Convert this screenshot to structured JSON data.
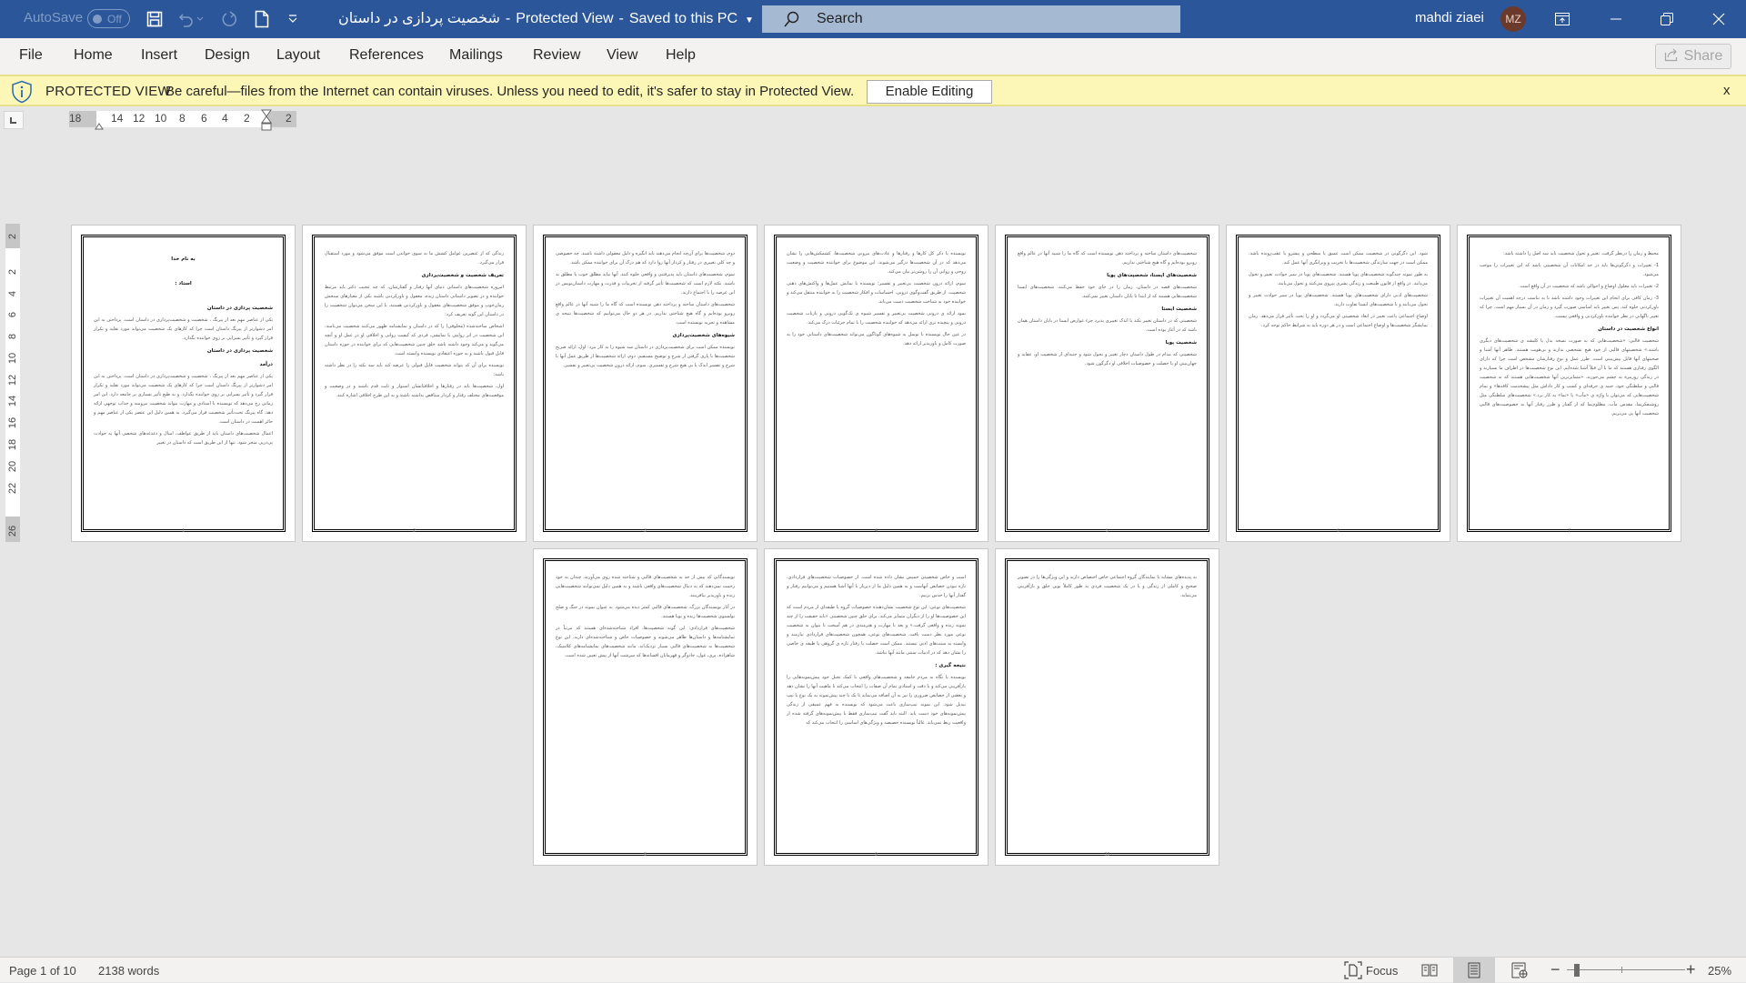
{
  "titlebar": {
    "autosave_label": "AutoSave",
    "autosave_state": "Off",
    "doc_title": "شخصیت پردازی در داستان",
    "view_mode": "Protected View",
    "save_status": "Saved to this PC",
    "search_placeholder": "Search",
    "user_name": "mahdi ziaei",
    "user_initials": "MZ",
    "icons": [
      "save-icon",
      "undo-icon",
      "redo-icon",
      "new-document-icon",
      "customize-toolbar-icon"
    ]
  },
  "menu": {
    "items": [
      "File",
      "Home",
      "Insert",
      "Design",
      "Layout",
      "References",
      "Mailings",
      "Review",
      "View",
      "Help"
    ],
    "share_label": "Share"
  },
  "protected_view": {
    "title": "PROTECTED VIEW",
    "message": "Be careful—files from the Internet can contain viruses. Unless you need to edit, it's safer to stay in Protected View.",
    "enable_label": "Enable Editing",
    "close_label": "x"
  },
  "rulers": {
    "horizontal": [
      "18",
      "14",
      "12",
      "10",
      "8",
      "6",
      "4",
      "2",
      "2"
    ],
    "vertical": [
      "2",
      "2",
      "4",
      "6",
      "8",
      "10",
      "12",
      "14",
      "16",
      "18",
      "20",
      "22",
      "26"
    ]
  },
  "pages": [
    {
      "number": "1",
      "blocks": [
        {
          "type": "title",
          "text": "به نام خدا"
        },
        {
          "type": "title",
          "text": "استاد :"
        },
        {
          "type": "h",
          "text": "شخصیت پردازی در داستان"
        },
        {
          "type": "p",
          "text": "یکی از عناصر مهم بعد از پیرنگ ، شخصیت و شخصیت‌پردازی در داستان است. پرداختن به این امر دشوارتر از پیرنگ داستان است چرا که کارهای یک شخصیت می‌تواند مورد تقلید و تکرار قرار گیرد و تأثیر بسزایی بر روی خواننده بگذارد."
        },
        {
          "type": "h",
          "text": "شخصیت پردازی در داستان"
        },
        {
          "type": "h",
          "text": "درآمد"
        },
        {
          "type": "p",
          "text": "یکی از عناصر مهم بعد از پیرنگ ، شخصیت و شخصیت‌پردازی در داستان است. پرداختن به این امر دشوارتر از پیرنگ داستان است چرا که کارهای یک شخصیت می‌تواند مورد تقلید و تکرار قرار گیرد و تأثیر بسزایی بر روی خواننده بگذارد. و به طبع تأثیر بسیاری بر جامعه دارد. این امر زمانی رخ می‌دهد که نویسنده با استادی و مهارت بتواند شخصیت نیرومند و جذاب توجهی ارائه دهد. گاه پیرنگ تحت‌تأثیر شخصیت قرار می‌گیرد. به همین دلیل این عنصر یکی از عناصر مهم و حائز اهمیت در داستان است."
        },
        {
          "type": "p",
          "text": "اعمال شخصیت‌های داستان باید از طریق عواطف، امیال و دغدغه‌های شخصی آنها به حوادث پی‌درپی منجر شود. تنها از این طریق است که داستان در تغییر"
        }
      ]
    },
    {
      "number": "2",
      "blocks": [
        {
          "type": "p",
          "text": "زندگی که از عنصرین عوامل کشش ما به سوی خواندن است موفق می‌شود و مورد استقبال قرار می‌گیرد."
        },
        {
          "type": "h",
          "text": "تعریف شخصیت و شخصیت‌پردازی"
        },
        {
          "type": "p",
          "text": "امروزه شخصیت‌های داستانی دنیای آنها رفتار و گفتارشان، که چه عجیب دکتر باید مرتبط خواننده و در تصویر داستانی داستان زنده، معقول و باورکردنی باشند یکی از معیارهای سنجش رمان‌خوب و موفق شخصیت‌های معقول و باورکردنی هستند. با این سخن می‌توان شخصیت را در داستان این گونه تعریف کرد:"
        },
        {
          "type": "p",
          "text": "اشخاص ساخته‌شده (مخلوقی) را که در داستان و نمایشنامه ظهور می‌کنند شخصیت می‌نامند. این شخصیت در اثر روایتی یا نمایشی، فردی که کیفیت روانی و اخلاقی او در عمل او و آنچه می‌گوید و می‌کند وجود داشته باشد خلق چنین شخصیت‌هایی که برای خواننده در حوزه داستان قابل قبول باشند و به حوزه اعتقادی نویسنده وابسته است."
        },
        {
          "type": "p",
          "text": "نویسنده برای آن که بتواند شخصیت قابل قبولی را عرضه کند باید سه نکته را در نظر داشته باشد:"
        },
        {
          "type": "p",
          "text": "اول، شخصیت‌ها باید در رفتارها و اخلاقیاتشان استوار و ثابت قدم باشند و در وضعیت و موقعیت‌های مختلف رفتار و کردار متناقض نداشته باشند و به این طرح اخلاقی اشاره کنند."
        }
      ]
    },
    {
      "number": "3",
      "blocks": [
        {
          "type": "p",
          "text": "دوم، شخصیت‌ها برای آن‌چه انجام می‌دهند باید انگیزه و دلیل معقولی داشته باشند. چه خصوصی و چه کلی تغییری در رفتار و کردار آنها روا دارد که هم درک آن برای خواننده ممکن باشد."
        },
        {
          "type": "p",
          "text": "سوم، شخصیت‌های داستان باید پذیرفتنی و واقعی جلوه کنند. آنها نباید مطلق خوب یا مطلق بد باشند. نکته لازم است که شخصیت‌ها تأثیر گرفته از تجربیات و قدرت و مهارت داستان‌نویس در این عرصه را با اجتماع دارند."
        },
        {
          "type": "p",
          "text": "شخصیت‌های داستان ساخته و پرداخته ذهن نویسنده است که گاه ما را شبیه آنها در عالم واقع روبرو بوده‌ایم و گاه هیچ شناختی نداریم. در هر دو حال می‌توانیم که شخصیت‌ها نتیجه ی مشاهده و تجربه نویسنده است."
        },
        {
          "type": "h",
          "text": "شیوه‌های شخصیت‌پردازی"
        },
        {
          "type": "p",
          "text": "نویسنده ممکن است برای شخصیت‌پردازی در داستان سه شیوه را به کار ببرد: اول، ارائه صریح شخصیت‌ها با یاری گرفتن از شرح و توضیح مستقیم. دوم، ارائه شخصیت‌ها از طریق عمل آنها با شرح و تفسیر اندک یا بی هیچ شرح و تفسیری. سوم، ارائه درون شخصیت بی‌تعبیر و تفسیر."
        }
      ]
    },
    {
      "number": "4",
      "blocks": [
        {
          "type": "p",
          "text": "نویسنده با ذکر کل کارها و رفتار‌ها و عادت‌های بیرونی شخصیت‌ها، کشمکش‌هایی را نشان می‌دهد که در آن شخصیت‌ها درگیر می‌شوند. این موضوع برای خواننده شخصیت و وضعیت روحی و روانی آن را روشن‌تر بیان می‌کند."
        },
        {
          "type": "p",
          "text": "سوم، ارائه درون شخصیت بی‌تعبیر و تفسیر؛ نویسنده با نمایش عمل‌ها و واکنش‌های ذهنی شخصیت، از طریق گفت‌وگوی درونی، احساسات و افکار شخصیت را به خواننده منتقل می‌کند و خواننده خود به شناخت شخصیت دست می‌یابد."
        },
        {
          "type": "p",
          "text": "نمود ارائه ی درونی شخصیت بی‌تعبیر و تفسیر شیوه ی تک‌گویی درونی و بازتاب شخصیت درونی و پیچیده تری ارائه می‌دهد که خواننده شخصیت را با تمام جزئیات درک می‌کند."
        },
        {
          "type": "p",
          "text": "در عین حال نویسنده با توسل به شیوه‌های گوناگون می‌تواند شخصیت‌های داستانی خود را به صورت کامل و باورپذیر ارائه دهد."
        }
      ]
    },
    {
      "number": "5",
      "blocks": [
        {
          "type": "p",
          "text": "شخصیت‌های داستان ساخته و پرداخته ذهن نویسنده است که گاه ما را شبیه آنها در عالم واقع روبرو بوده‌ایم و گاه هیچ شناختی نداریم."
        },
        {
          "type": "h",
          "text": "شخصیت‌های ایستا، شخصیت‌های پویا"
        },
        {
          "type": "p",
          "text": "شخصیت‌های قصه در داستان، زمان را در جای خود حفظ می‌کنند. شخصیت‌های ایستا شخصیت‌هایی هستند که از ابتدا تا پایان داستان تغییر نمی‌کنند."
        },
        {
          "type": "h",
          "text": "شخصیت ایستا"
        },
        {
          "type": "p",
          "text": "شخصیتی که در داستان تغییر نکند یا اندک تغییری پذیرد جزء عوارض ایستا در پایان داستان همان باشد که در آغاز بوده است."
        },
        {
          "type": "h",
          "text": "شخصیت پویا"
        },
        {
          "type": "p",
          "text": "شخصیتی که مدام در طول داستان دچار تغییر و تحول شود و جنبه‌ای از شخصیت او، عقاید و جهان‌بینی او یا خصلت و خصوصیات اخلاقی او دگرگون شود."
        }
      ]
    },
    {
      "number": "6",
      "blocks": [
        {
          "type": "p",
          "text": "شود. این دگرگونی در شخصیت ممکن است عمیق یا سطحی و پیشرو یا عقب‌رونده باشد. ممکن است در جهت سازندگی شخصیت‌ها یا تخریب و ویرانگری آنها عمل کند."
        },
        {
          "type": "p",
          "text": "به طور نمونه چندگونه شخصیت‌های پویا هستند. شخصیت‌های پویا در سیر حوادث تغییر و تحول می‌یابند. در واقع از قانون طبیعت و زندگی بشری پیروی می‌کنند و تحول می‌یابند."
        },
        {
          "type": "p",
          "text": "شخصیت‌های ادبی دارای شخصیت‌های پویا هستند. شخصیت‌های پویا در سیر حوادث تغییر و تحول می‌یابند و با شخصیت‌های ایستا تفاوت دارند."
        },
        {
          "type": "p",
          "text": "اوضاع اجتماعی باعث تغییر در ابعاد شخصیتی او می‌گردد و او را تحت تأثیر قرار می‌دهد. رمان نمایشگر شخصیت‌ها و اوضاع اجتماعی است و در هر دوره باید به شرایط حاکم توجه کرد."
        }
      ]
    },
    {
      "number": "7",
      "blocks": [
        {
          "type": "p",
          "text": "محیط و زمان را درنظر گرفت. تغییر و تحول شخصیت باید سه اصل را داشته باشد:"
        },
        {
          "type": "p",
          "text": "1- تغییرات و دگرگونی‌ها باید در حد امکانات آن شخصیتی باشد که این تغییرات را موجب می‌شود."
        },
        {
          "type": "p",
          "text": "2- تغییرات باید معلول اوضاع و احوالی باشد که شخصیت در آن واقع است."
        },
        {
          "type": "p",
          "text": "3- زمان کافی برای انجام این تغییرات وجود داشته باشد تا به تناسب درجه اهمیت آن تغییرات باورکردنی جلوه کند. پس تغییر باید اساسی صورت گیرد و زمان در آن بسیار مهم است. چرا که تغییر ناگهانی در نظر خواننده باورکردنی و واقعی نیست."
        },
        {
          "type": "h",
          "text": "انواع شخصیت در داستان"
        },
        {
          "type": "p",
          "text": "شخصیت قالبی: «شخصیت‌هایی که به صورت نسخه بدل یا کلیشه ی شخصیت‌های دیگری باشند.» شخصیتهای قالبی از خود هیچ تشخصی ندارند و بی‌هویت هستند. ظاهر آنها آشنا و صحبتهای آنها قابل پیش‌بینی است. طرز عمل و نوع رفتارشان مشخص است چرا که دارای الگوی رفتاری هستند که ما با آن قبلاً آشنا شده‌ایم. این نوع شخصیت‌ها در اطراف ما بسیارند و در زندگی روزمره به چشم می‌خورند. «متمایزترین آنها شخصیت‌هایی هستند که به شخصیت قالبی و سلطنگی خود، جنبه ی حرفه‌ای و کسب و کار داداش مثل پیشخدمت کافه‌ها» و تمام شخصیت‌هایی که می‌توان با واژه ی «مآب» یا «نما» به کار برد.» شخصیت‌های سلطنگی مثل روشنفکرنما، مقدس مآب، مظلوم‌نما که از گفتار و طرز رفتار آنها به خصوصیت‌های قالبی شخصیت آنها پی می‌بریم."
        }
      ]
    },
    {
      "number": "8",
      "blocks": [
        {
          "type": "p",
          "text": "نویسندگانی که بیش از حد به شخصیت‌های قالبی و شناخته شده روی می‌آورند، چندان به خود زحمت نمی‌دهند که به دنبال شخصیت‌های واقعی باشند و به همین دلیل نمی‌توانند شخصیت‌هایی زنده و باورپذیر بیافرینند."
        },
        {
          "type": "p",
          "text": "در آثار نویسندگان بزرگ، شخصیت‌های قالبی کمتر دیده می‌شود. به عنوان نمونه در جنگ و صلح تولستوی شخصیت‌ها زنده و پویا هستند."
        },
        {
          "type": "p",
          "text": "شخصیت‌های قراردادی: این گونه شخصیت‌ها، افراد شناخته‌شده‌ای هستند که مرتباً در نمایشنامه‌ها و داستان‌ها ظاهر می‌شوند و خصوصیات خاص و شناخته‌شده‌ای دارند. این نوع شخصیت‌ها به شخصیت‌های قالبی بسیار نزدیک‌اند. مانند شخصیت‌های نمایشنامه‌های کلاسیک، شاهزاده، پری، غول، جادوگر و قهرمانان افسانه‌ها که سرشت آنها از پیش تعیین شده است."
        }
      ]
    },
    {
      "number": "9",
      "blocks": [
        {
          "type": "p",
          "text": "است و خاص شخصیتی خمیس نشان داده شده است. از خصوصیات شخصیت‌های قراردادی، تازه نبودن خصایص آنهاست و به همین دلیل ما از دیرباز با آنها آشنا هستیم و می‌توانیم رفتار و گفتار آنها را حدس بزنیم."
        },
        {
          "type": "p",
          "text": "شخصیت‌های نوعی: این نوع شخصیت نشان‌دهنده خصوصیات گروه یا طبقه‌ای از مردم است که این خصوصیت‌ها او را از دیگران متمایز می‌کند. برای خلق چنین شخصیتی «باید حقیقت را از چند نمونه زنده و واقعی گرفت.» و بعد با مهارت و هنرمندی در هم آمیخت تا بتوان به شخصیت نوعی مورد نظر دست یافت. شخصیت‌های نوعی، همچون شخصیت‌های قراردادی نیازمند و وابسته به سنت‌های ادبی نیستند. ممکن است خصلت یا رفتار تازه ی گروهی یا طبقه ی خاصی را نشان دهد که در ادبیات سنتی مانند آنها نباشد."
        },
        {
          "type": "h",
          "text": "نتیجه گیری :"
        },
        {
          "type": "p",
          "text": "نویسنده با نگاه به مردم جامعه و شخصیت‌های واقعی با کمک تخیل خود پیش‌نمونه‌هایی را بازآفرینی می‌کند و با دقت و استادی تمام آن صفات را انتخاب می‌کند تا ماهیت آنها را نشان دهد و بعضی از خصایص ضروری را نیز به آن اضافه می‌نماید تا یک یا چند پیش‌نمونه به یک نوع یا تیپ تبدیل شود. این نمونه تیپ‌سازی باعث می‌شود که نویسنده به فهم عمیقی از زندگی پیش‌نمونه‌های خود دست یابد. البته باید گفت تیپ‌سازی فقط با پیش‌نمونه‌های گرفته شده از واقعیت ربط نمی‌یابد. غالباً نویسنده خصیصه و ویژگی‌های اساسی را انتخاب می‌کند که"
        }
      ]
    },
    {
      "number": "10",
      "blocks": [
        {
          "type": "p",
          "text": "به پدیده‌های مشابه یا نمایندگان گروه اجتماعی خاص اختصاص دارند و این ویژگی‌ها را در تصویر صحیح و کاملی از زندگی و یا در یک شخصیت فردی به طور کاملاً نوین خلق و بازآفرینی می‌نماید."
        }
      ]
    }
  ],
  "statusbar": {
    "page_info": "Page 1 of 10",
    "word_count": "2138 words",
    "focus_label": "Focus",
    "zoom_level": "25%",
    "zoom_fraction": 0.25,
    "active_view": "print-layout"
  }
}
